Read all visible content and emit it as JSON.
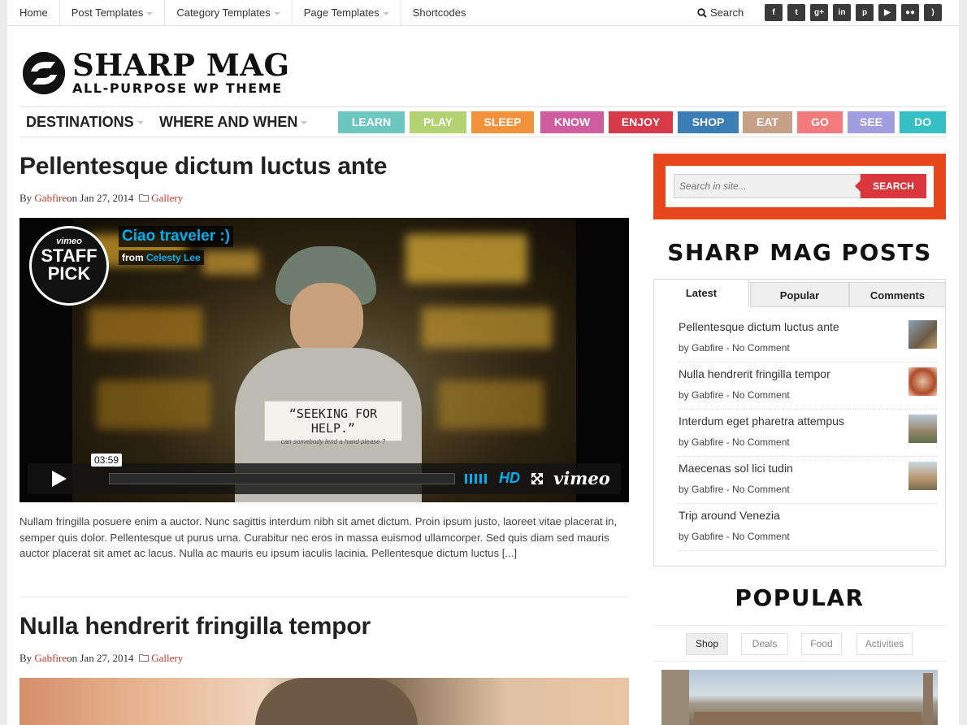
{
  "topnav": {
    "items": [
      "Home",
      "Post Templates",
      "Category Templates",
      "Page Templates",
      "Shortcodes"
    ],
    "search_label": "Search",
    "social_icons": [
      "facebook-icon",
      "twitter-icon",
      "google-plus-icon",
      "linkedin-icon",
      "pinterest-icon",
      "youtube-icon",
      "flickr-icon",
      "rss-icon"
    ]
  },
  "logo": {
    "title": "SHARP MAG",
    "subtitle": "ALL-PURPOSE WP THEME"
  },
  "mainnav": {
    "items": [
      "DESTINATIONS",
      "WHERE AND WHEN"
    ],
    "categories": [
      {
        "label": "LEARN",
        "color": "#6ec6c0"
      },
      {
        "label": "PLAY",
        "color": "#b3d373"
      },
      {
        "label": "SLEEP",
        "color": "#f2923a"
      },
      {
        "label": "KNOW",
        "color": "#d05ca0"
      },
      {
        "label": "ENJOY",
        "color": "#d93a4a"
      },
      {
        "label": "SHOP",
        "color": "#3b7db5"
      },
      {
        "label": "EAT",
        "color": "#c7a088"
      },
      {
        "label": "GO",
        "color": "#f47a7e"
      },
      {
        "label": "SEE",
        "color": "#a09ee0"
      },
      {
        "label": "DO",
        "color": "#36c0c6"
      }
    ]
  },
  "posts": [
    {
      "title": "Pellentesque dictum luctus ante",
      "by": "By",
      "author": "Gabfire",
      "on": "on Jan 27, 2014",
      "category": "Gallery",
      "video": {
        "title": "Ciao traveler :)",
        "from": "from",
        "author": "Celesty Lee",
        "badge_top": "vimeo",
        "badge_main1": "STAFF",
        "badge_main2": "PICK",
        "sign_text": "“SEEKING FOR HELP.”",
        "sign_sub": "can somebody lend a hand please ?",
        "time": "03:59",
        "hd": "HD",
        "brand": "vimeo"
      },
      "excerpt": "Nullam fringilla posuere enim a auctor. Nunc sagittis interdum nibh sit amet dictum. Proin ipsum justo, laoreet vitae placerat in, semper quis dolor. Pellentesque ut purus urna. Curabitur nec eros in massa euismod ullamcorper. Sed quis diam sed mauris auctor placerat sit amet ac lacus. Nulla ac mauris eu ipsum iaculis lacinia. Pellentesque dictum luctus [...]"
    },
    {
      "title": "Nulla hendrerit fringilla tempor",
      "by": "By",
      "author": "Gabfire",
      "on": "on Jan 27, 2014",
      "category": "Gallery"
    }
  ],
  "sidebar": {
    "search_placeholder": "Search in site...",
    "search_button": "SEARCH",
    "posts_widget_title": "SHARP MAG POSTS",
    "tabs": [
      "Latest",
      "Popular",
      "Comments"
    ],
    "latest": [
      {
        "title": "Pellentesque dictum luctus ante",
        "meta": "by Gabfire - No Comment"
      },
      {
        "title": "Nulla hendrerit fringilla tempor",
        "meta": "by Gabfire - No Comment"
      },
      {
        "title": "Interdum eget pharetra attempus",
        "meta": "by Gabfire - No Comment"
      },
      {
        "title": "Maecenas sol lici tudin",
        "meta": "by Gabfire - No Comment"
      },
      {
        "title": "Trip around Venezia",
        "meta": "by Gabfire - No Comment"
      }
    ],
    "popular_title": "POPULAR",
    "popular_tabs": [
      "Shop",
      "Deals",
      "Food",
      "Activities"
    ]
  }
}
